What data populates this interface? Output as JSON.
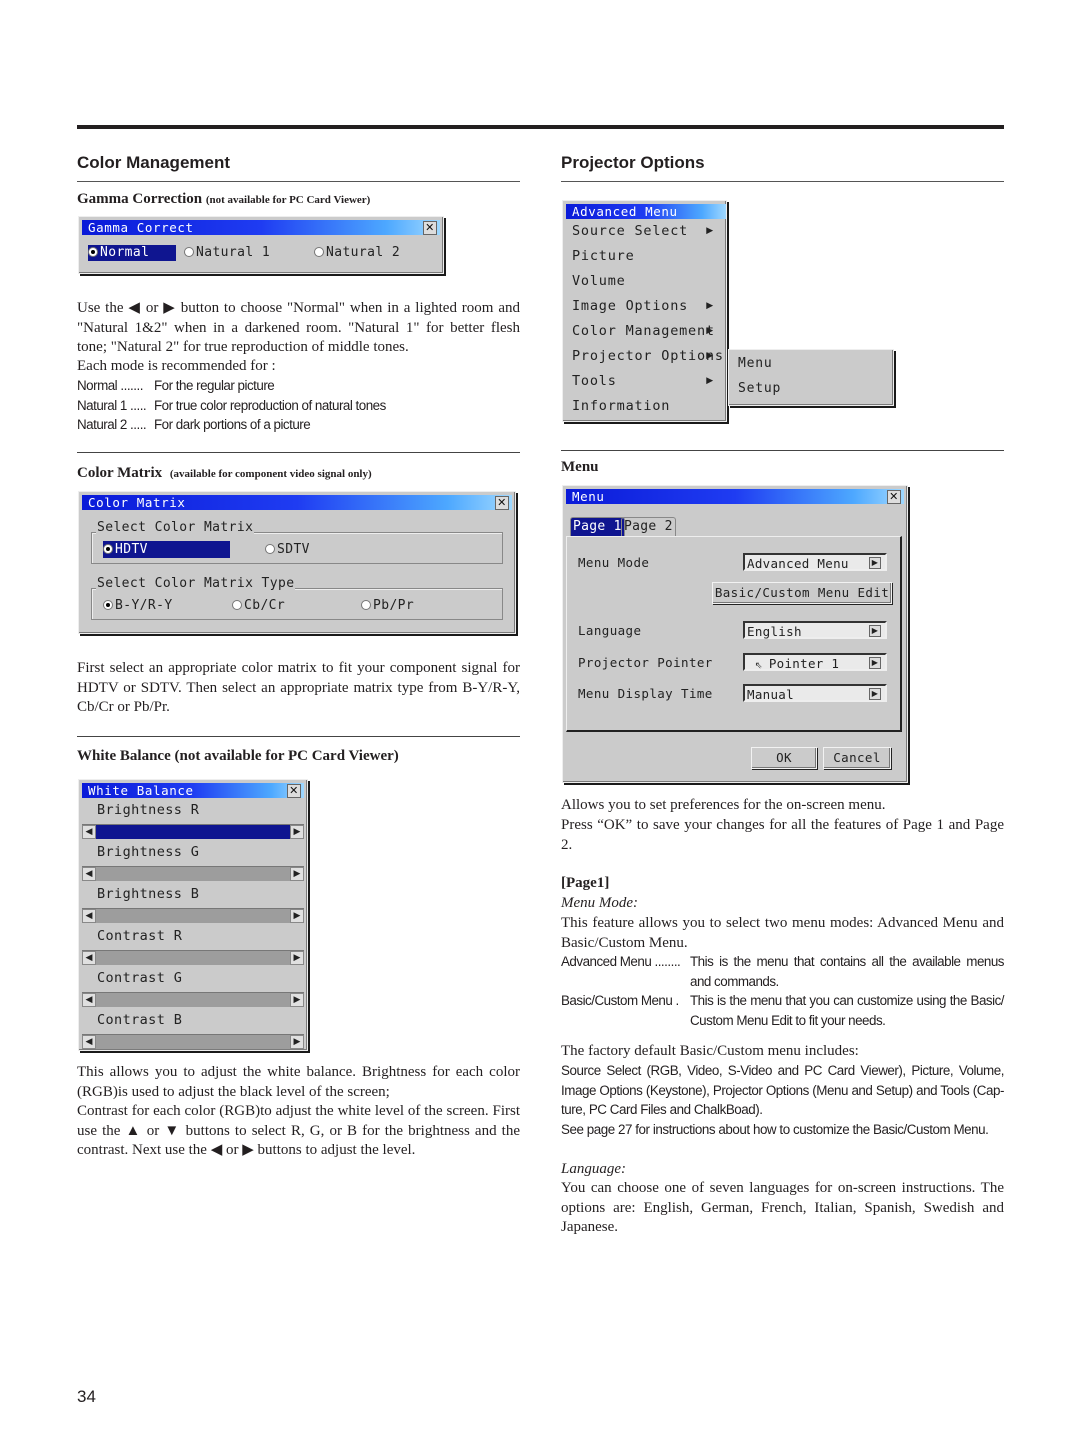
{
  "page_number": "34",
  "left": {
    "section_title": "Color Management",
    "gamma": {
      "heading": "Gamma Correction",
      "heading_note": "(not available for PC Card Viewer)",
      "window_title": "Gamma Correct",
      "options": [
        "Normal",
        "Natural 1",
        "Natural 2"
      ],
      "selected": "Normal",
      "para_1": "Use the ◀ or ▶ button to choose \"Normal\" when in a lighted room and \"Natural 1&2\" when in a darkened room. \"Natural 1\" for better flesh tone; \"Natural 2\" for true reproduction of middle tones.",
      "para_2": "Each mode is recommended for :",
      "modes": [
        {
          "term": "Normal .......",
          "desc": "For the regular picture"
        },
        {
          "term": "Natural 1 .....",
          "desc": "For true color reproduction of natural tones"
        },
        {
          "term": "Natural 2 .....",
          "desc": "For dark portions of a picture"
        }
      ]
    },
    "color_matrix": {
      "heading": "Color Matrix",
      "heading_note": "(available for component video signal only)",
      "window_title": "Color Matrix",
      "group1_label": "Select Color Matrix",
      "group1_options": [
        "HDTV",
        "SDTV"
      ],
      "group1_selected": "HDTV",
      "group2_label": "Select Color Matrix Type",
      "group2_options": [
        "B-Y/R-Y",
        "Cb/Cr",
        "Pb/Pr"
      ],
      "group2_selected": "B-Y/R-Y",
      "para": "First select an appropriate color matrix to fit your component signal for HDTV or SDTV. Then select an appropriate matrix type from B-Y/R-Y, Cb/Cr or Pb/Pr."
    },
    "white_balance": {
      "heading": "White Balance (not available for PC Card Viewer)",
      "window_title": "White Balance",
      "sliders": [
        "Brightness R",
        "Brightness G",
        "Brightness B",
        "Contrast R",
        "Contrast G",
        "Contrast B"
      ],
      "active_slider": "Brightness R",
      "para_1": "This allows you to adjust the white balance. Brightness for each color (RGB)is used to adjust the black level of the screen;",
      "para_2": "Contrast for each color (RGB)to adjust the white level of the screen. First use the ▲ or ▼ buttons to select R, G, or B for the brightness and the contrast. Next use the ◀ or ▶ buttons to adjust the level."
    }
  },
  "right": {
    "section_title": "Projector Options",
    "advanced_menu": {
      "title": "Advanced Menu",
      "items": [
        {
          "label": "Source Select",
          "submenu": true
        },
        {
          "label": "Picture",
          "submenu": false
        },
        {
          "label": "Volume",
          "submenu": false
        },
        {
          "label": "Image Options",
          "submenu": true
        },
        {
          "label": "Color Management",
          "submenu": true
        },
        {
          "label": "Projector Options",
          "submenu": true
        },
        {
          "label": "Tools",
          "submenu": true
        },
        {
          "label": "Information",
          "submenu": false
        }
      ],
      "submenu_items": [
        "Menu",
        "Setup"
      ]
    },
    "menu": {
      "heading": "Menu",
      "window_title": "Menu",
      "tabs": [
        "Page 1",
        "Page 2"
      ],
      "active_tab": "Page 1",
      "rows": [
        {
          "label": "Menu Mode",
          "value": "Advanced Menu"
        },
        {
          "label": "Language",
          "value": "English"
        },
        {
          "label": "Projector Pointer",
          "value": "Pointer 1"
        },
        {
          "label": "Menu Display Time",
          "value": "Manual"
        }
      ],
      "edit_button": "Basic/Custom Menu Edit",
      "ok_button": "OK",
      "cancel_button": "Cancel",
      "para_1": "Allows you to set preferences for the on-screen menu.",
      "para_2": "Press “OK” to save your changes for all the features of Page 1 and Page 2."
    },
    "page1": {
      "heading": "[Page1]",
      "menu_mode_title": "Menu Mode:",
      "menu_mode_para": "This feature allows you to select two menu modes: Advanced Menu and Basic/Custom Menu.",
      "modes": [
        {
          "term": "Advanced Menu ........",
          "desc": "This is the menu that contains all the available menus and commands."
        },
        {
          "term": "Basic/Custom Menu .",
          "desc": "This is the menu that you can customize using the Basic/ Custom Menu Edit to fit your needs."
        }
      ],
      "factory_para": "The factory default Basic/Custom menu includes:",
      "factory_list": "Source Select (RGB, Video, S-Video and PC Card Viewer), Picture, Volume, Image Options (Keystone), Projector Options (Menu and Setup) and Tools (Cap-ture, PC Card Files and ChalkBoad).",
      "see_page": "See page 27 for instructions about how to customize the Basic/Custom Menu.",
      "language_title": "Language:",
      "language_para": "You can choose one of seven languages for on-screen instructions. The options are: English, German, French, Italian, Spanish, Swedish and Japanese."
    }
  }
}
